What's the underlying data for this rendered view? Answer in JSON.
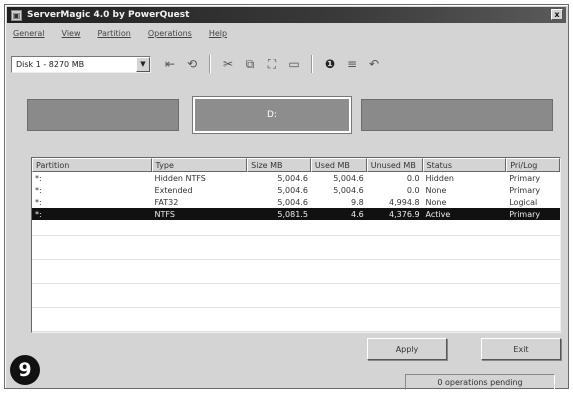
{
  "window": {
    "title": "ServerMagic 4.0 by PowerQuest",
    "close_glyph": "x"
  },
  "menu": [
    "General",
    "View",
    "Partition",
    "Operations",
    "Help"
  ],
  "toolbar": {
    "disk_select": "Disk 1 - 8270 MB",
    "icons": [
      "back-arrow-icon",
      "undo-icon",
      "cut-icon",
      "copy-icon",
      "resize-icon",
      "move-icon",
      "info-icon",
      "properties-icon",
      "redo-icon"
    ]
  },
  "diskmap": {
    "selected_label": "D:"
  },
  "table": {
    "headers": [
      "Partition",
      "Type",
      "Size MB",
      "Used MB",
      "Unused MB",
      "Status",
      "Pri/Log"
    ],
    "rows": [
      [
        "*:",
        "Hidden NTFS",
        "5,004.6",
        "5,004.6",
        "0.0",
        "Hidden",
        "Primary"
      ],
      [
        "*:",
        "Extended",
        "5,004.6",
        "5,004.6",
        "0.0",
        "None",
        "Primary"
      ],
      [
        "*:",
        "FAT32",
        "5,004.6",
        "9.8",
        "4,994.8",
        "None",
        "Logical"
      ],
      [
        "*:",
        "NTFS",
        "5,081.5",
        "4.6",
        "4,376.9",
        "Active",
        "Primary"
      ]
    ],
    "selected_row": 3
  },
  "buttons": {
    "apply": "Apply",
    "exit": "Exit"
  },
  "status": {
    "pending": "0 operations pending"
  },
  "badge": {
    "step": "9"
  }
}
